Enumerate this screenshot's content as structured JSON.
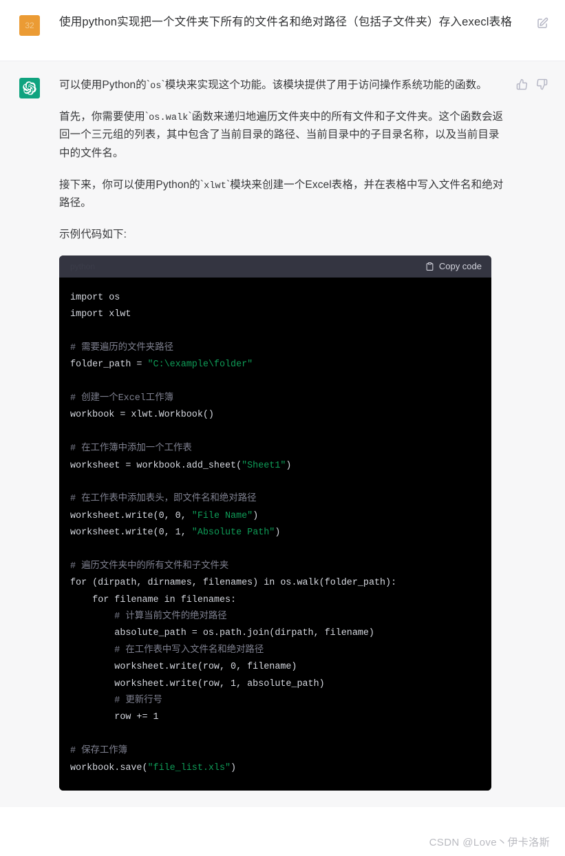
{
  "colors": {
    "user_avatar_bg": "#eb9b34",
    "assistant_avatar_bg": "#10a37f",
    "assistant_row_bg": "#f7f7f8",
    "code_header_bg": "#343541",
    "code_body_bg": "#000000",
    "code_string": "#0f9d58",
    "code_comment": "#7f8190"
  },
  "user_message": {
    "avatar_label": "32",
    "text": "使用python实现把一个文件夹下所有的文件名和绝对路径（包括子文件夹）存入execl表格",
    "edit_icon": "edit-square-icon"
  },
  "assistant_message": {
    "avatar_icon": "openai-logo-icon",
    "paragraphs": [
      {
        "segments": [
          {
            "type": "text",
            "value": "可以使用Python的`"
          },
          {
            "type": "code",
            "value": "os"
          },
          {
            "type": "text",
            "value": "`模块来实现这个功能。该模块提供了用于访问操作系统功能的函数。"
          }
        ]
      },
      {
        "segments": [
          {
            "type": "text",
            "value": "首先，你需要使用`"
          },
          {
            "type": "code",
            "value": "os.walk"
          },
          {
            "type": "text",
            "value": "`函数来递归地遍历文件夹中的所有文件和子文件夹。这个函数会返回一个三元组的列表，其中包含了当前目录的路径、当前目录中的子目录名称，以及当前目录中的文件名。"
          }
        ]
      },
      {
        "segments": [
          {
            "type": "text",
            "value": "接下来，你可以使用Python的`"
          },
          {
            "type": "code",
            "value": "xlwt"
          },
          {
            "type": "text",
            "value": "`模块来创建一个Excel表格，并在表格中写入文件名和绝对路径。"
          }
        ]
      },
      {
        "segments": [
          {
            "type": "text",
            "value": "示例代码如下:"
          }
        ]
      }
    ],
    "thumbs_up_icon": "thumbs-up-icon",
    "thumbs_down_icon": "thumbs-down-icon"
  },
  "code_block": {
    "language_label": "python",
    "copy_label": "Copy code",
    "copy_icon": "clipboard-icon",
    "lines": [
      [
        {
          "t": "kw",
          "v": "import"
        },
        {
          "t": "plain",
          "v": " os"
        }
      ],
      [
        {
          "t": "kw",
          "v": "import"
        },
        {
          "t": "plain",
          "v": " xlwt"
        }
      ],
      [],
      [
        {
          "t": "com",
          "v": "# 需要遍历的文件夹路径"
        }
      ],
      [
        {
          "t": "plain",
          "v": "folder_path = "
        },
        {
          "t": "str",
          "v": "\"C:\\example\\folder\""
        }
      ],
      [],
      [
        {
          "t": "com",
          "v": "# 创建一个Excel工作簿"
        }
      ],
      [
        {
          "t": "plain",
          "v": "workbook = xlwt.Workbook()"
        }
      ],
      [],
      [
        {
          "t": "com",
          "v": "# 在工作簿中添加一个工作表"
        }
      ],
      [
        {
          "t": "plain",
          "v": "worksheet = workbook.add_sheet("
        },
        {
          "t": "str",
          "v": "\"Sheet1\""
        },
        {
          "t": "plain",
          "v": ")"
        }
      ],
      [],
      [
        {
          "t": "com",
          "v": "# 在工作表中添加表头，即文件名和绝对路径"
        }
      ],
      [
        {
          "t": "plain",
          "v": "worksheet.write(0, 0, "
        },
        {
          "t": "str",
          "v": "\"File Name\""
        },
        {
          "t": "plain",
          "v": ")"
        }
      ],
      [
        {
          "t": "plain",
          "v": "worksheet.write(0, 1, "
        },
        {
          "t": "str",
          "v": "\"Absolute Path\""
        },
        {
          "t": "plain",
          "v": ")"
        }
      ],
      [],
      [
        {
          "t": "com",
          "v": "# 遍历文件夹中的所有文件和子文件夹"
        }
      ],
      [
        {
          "t": "kw",
          "v": "for"
        },
        {
          "t": "plain",
          "v": " (dirpath, dirnames, filenames) "
        },
        {
          "t": "kw",
          "v": "in"
        },
        {
          "t": "plain",
          "v": " os.walk(folder_path):"
        }
      ],
      [
        {
          "t": "plain",
          "v": "    "
        },
        {
          "t": "kw",
          "v": "for"
        },
        {
          "t": "plain",
          "v": " filename "
        },
        {
          "t": "kw",
          "v": "in"
        },
        {
          "t": "plain",
          "v": " filenames:"
        }
      ],
      [
        {
          "t": "com",
          "v": "        # 计算当前文件的绝对路径"
        }
      ],
      [
        {
          "t": "plain",
          "v": "        absolute_path = os.path.join(dirpath, filename)"
        }
      ],
      [
        {
          "t": "com",
          "v": "        # 在工作表中写入文件名和绝对路径"
        }
      ],
      [
        {
          "t": "plain",
          "v": "        worksheet.write(row, 0, filename)"
        }
      ],
      [
        {
          "t": "plain",
          "v": "        worksheet.write(row, 1, absolute_path)"
        }
      ],
      [
        {
          "t": "com",
          "v": "        # 更新行号"
        }
      ],
      [
        {
          "t": "plain",
          "v": "        row += 1"
        }
      ],
      [],
      [
        {
          "t": "com",
          "v": "# 保存工作簿"
        }
      ],
      [
        {
          "t": "plain",
          "v": "workbook.save("
        },
        {
          "t": "str",
          "v": "\"file_list.xls\""
        },
        {
          "t": "plain",
          "v": ")"
        }
      ]
    ]
  },
  "watermark": {
    "text": "CSDN @Love丶伊卡洛斯"
  }
}
